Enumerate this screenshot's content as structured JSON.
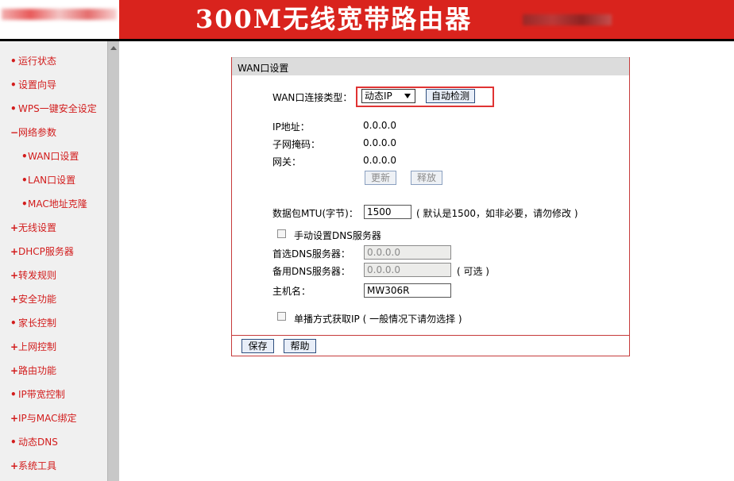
{
  "header": {
    "title": "300M无线宽带路由器",
    "brand_color": "#d9231d"
  },
  "sidebar": {
    "items": [
      {
        "label": "运行状态",
        "bullet": "•"
      },
      {
        "label": "设置向导",
        "bullet": "•"
      },
      {
        "label": "WPS一键安全设定",
        "bullet": "•"
      },
      {
        "label": "网络参数",
        "bullet": "−"
      },
      {
        "label": "WAN口设置",
        "bullet": "•"
      },
      {
        "label": "LAN口设置",
        "bullet": "•"
      },
      {
        "label": "MAC地址克隆",
        "bullet": "•"
      },
      {
        "label": "无线设置",
        "bullet": "+"
      },
      {
        "label": "DHCP服务器",
        "bullet": "+"
      },
      {
        "label": "转发规则",
        "bullet": "+"
      },
      {
        "label": "安全功能",
        "bullet": "+"
      },
      {
        "label": "家长控制",
        "bullet": "•"
      },
      {
        "label": "上网控制",
        "bullet": "+"
      },
      {
        "label": "路由功能",
        "bullet": "+"
      },
      {
        "label": "IP带宽控制",
        "bullet": "•"
      },
      {
        "label": "IP与MAC绑定",
        "bullet": "+"
      },
      {
        "label": "动态DNS",
        "bullet": "•"
      },
      {
        "label": "系统工具",
        "bullet": "+"
      }
    ]
  },
  "panel": {
    "title": "WAN口设置",
    "wan_type_label": "WAN口连接类型：",
    "wan_type_value": "动态IP",
    "auto_detect": "自动检测",
    "ip_label": "IP地址：",
    "ip_value": "0.0.0.0",
    "mask_label": "子网掩码：",
    "mask_value": "0.0.0.0",
    "gateway_label": "网关：",
    "gateway_value": "0.0.0.0",
    "renew": "更新",
    "release": "释放",
    "mtu_label": "数据包MTU(字节)：",
    "mtu_value": "1500",
    "mtu_hint": "( 默认是1500，如非必要，请勿修改 )",
    "manual_dns_label": "手动设置DNS服务器",
    "primary_dns_label": "首选DNS服务器：",
    "primary_dns_value": "0.0.0.0",
    "secondary_dns_label": "备用DNS服务器：",
    "secondary_dns_value": "0.0.0.0",
    "secondary_dns_hint": "( 可选 )",
    "hostname_label": "主机名：",
    "hostname_value": "MW306R",
    "unicast_label": "单播方式获取IP ( 一般情况下请勿选择 )",
    "save": "保存",
    "help": "帮助"
  }
}
